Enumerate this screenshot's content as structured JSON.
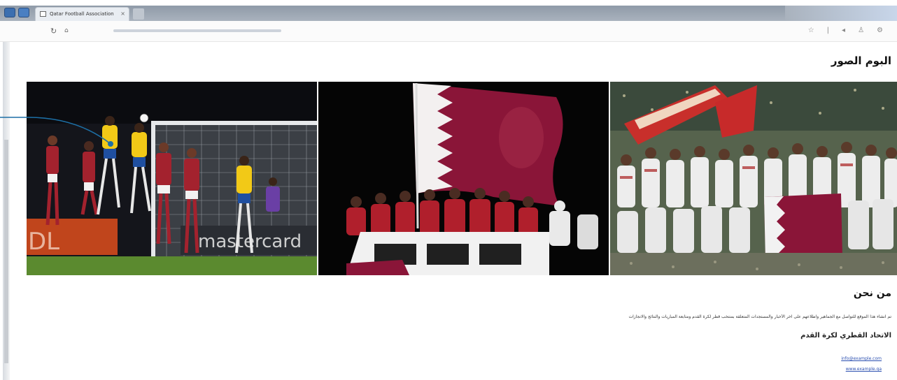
{
  "browser": {
    "tab_title": "Qatar Football Association",
    "tab_close_glyph": "×",
    "refresh_glyph": "↻",
    "home_glyph": "⌂",
    "url": "",
    "toolbar_icons": [
      "star-icon",
      "divider",
      "back-icon",
      "user-icon",
      "settings-icon"
    ]
  },
  "page": {
    "album_title": "البوم الصور",
    "photos": [
      {
        "name": "match-photo",
        "alt": "match header"
      },
      {
        "name": "flag-photo",
        "alt": "fans with flag"
      },
      {
        "name": "team-photo",
        "alt": "team celebration"
      }
    ],
    "about_title": "من نحن",
    "about_text": "تم انشاء هذا الموقع للتواصل مع الجماهير واطلاعهم على آخر الأخبار والمستجدات المتعلقة بمنتخب قطر لكرة القدم ومتابعة المباريات والنتائج والانجازات",
    "org_name": "الاتحاد القطري لكرة القدم",
    "link_email": "info@example.com",
    "link_site": "www.example.qa"
  },
  "colors": {
    "maroon": "#8a1538",
    "link": "#2b4fb0",
    "annotation": "#1d6fa5"
  }
}
